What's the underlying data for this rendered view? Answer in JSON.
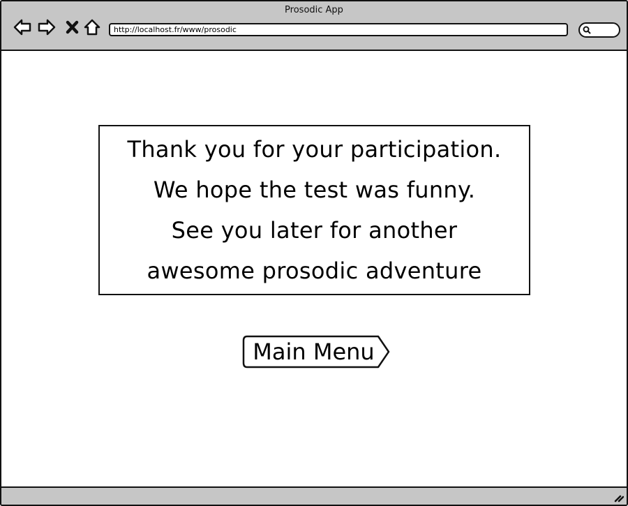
{
  "window": {
    "title": "Prosodic App"
  },
  "toolbar": {
    "url": "http://localhost.fr/www/prosodic",
    "icons": [
      "back-arrow-icon",
      "forward-arrow-icon",
      "close-icon",
      "home-icon",
      "search-icon"
    ]
  },
  "message": {
    "lines": [
      "Thank you for your participation.",
      "We hope the test was funny.",
      "See you later for another",
      "awesome prosodic adventure"
    ]
  },
  "main_menu_button": {
    "label": "Main Menu"
  },
  "colors": {
    "chrome": "#c6c6c6",
    "border": "#111111",
    "background": "#ffffff"
  }
}
